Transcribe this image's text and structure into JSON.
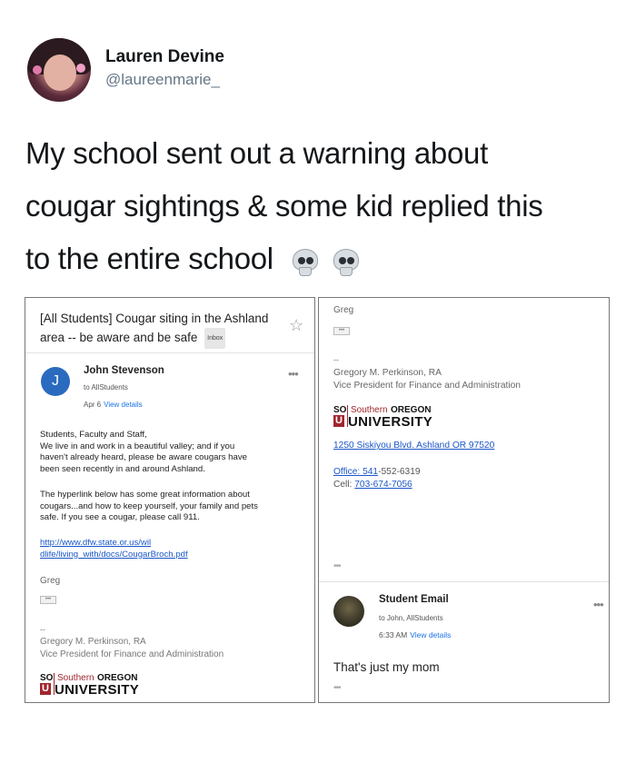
{
  "tweet": {
    "display_name": "Lauren Devine",
    "handle": "@laureenmarie_",
    "text_line1": "My school sent out a warning about",
    "text_line2": "cougar sightings & some kid replied this",
    "text_line3": "to the entire school",
    "emoji": [
      "skull-icon",
      "skull-icon"
    ]
  },
  "email1": {
    "subject_line1": "[All Students] Cougar siting in the Ashland",
    "subject_line2": "area -- be aware and be safe",
    "label": "Inbox",
    "avatar_letter": "J",
    "sender": "John Stevenson",
    "to": "to AllStudents",
    "date": "Apr 6",
    "view_details": "View details",
    "more": "•••",
    "body": [
      "Students, Faculty and Staff,",
      "We live in and work in a beautiful valley; and if you",
      "haven't already heard, please be aware cougars have",
      "been seen recently in and around Ashland."
    ],
    "body2": [
      "The hyperlink below has some great information about",
      "cougars...and how to keep yourself, your family and pets",
      "safe.  If you see a cougar, please call 911."
    ],
    "link_line1": "http://www.dfw.state.or.us/wil",
    "link_line2": "dlife/living_with/docs/CougarBroch.pdf",
    "sig_greeting": "Greg",
    "quote_toggle": "•••",
    "sig_dash": "--",
    "sig_name": "Gregory M. Perkinson, RA",
    "sig_title": "Vice President for Finance and Administration"
  },
  "logo": {
    "so": "SO",
    "u": "U",
    "southern": "Southern",
    "oregon": "OREGON",
    "university": "UNIVERSITY"
  },
  "email2": {
    "sig_greeting": "Greg",
    "quote_toggle": "•••",
    "sig_dash": "--",
    "sig_name": "Gregory M. Perkinson, RA",
    "sig_title": "Vice President for Finance and Administration",
    "address": "1250 Siskiyou Blvd. Ashland  OR 97520",
    "office_label": "Office: 541",
    "office_rest": "-552-6319",
    "cell_label": "Cell:",
    "cell_number": "703-674-7056",
    "trailing_dots": "•••"
  },
  "reply": {
    "sender": "Student Email",
    "to": "to John, AllStudents",
    "time": "6:33 AM",
    "view_details": "View details",
    "more": "•••",
    "message": "That's just my mom",
    "trailing_dots": "•••"
  }
}
